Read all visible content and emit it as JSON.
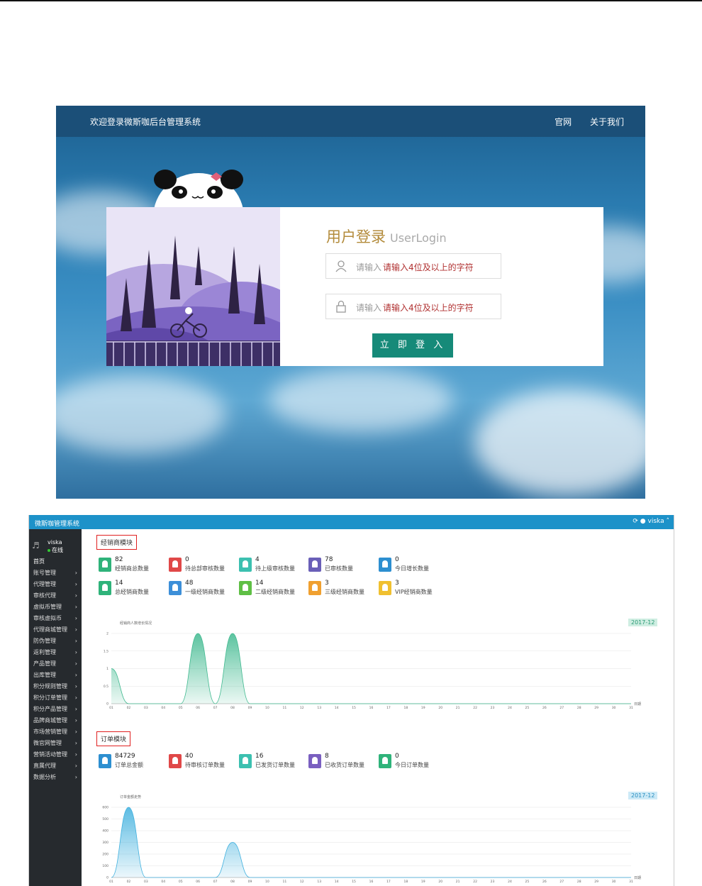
{
  "login": {
    "header_title": "欢迎登录微斯咖后台管理系统",
    "nav": [
      "官网",
      "关于我们"
    ],
    "heading": "用户登录",
    "heading_en": "UserLogin",
    "username": {
      "placeholder": "请输入",
      "hint": "请输入4位及以上的字符"
    },
    "password": {
      "placeholder": "请输入",
      "hint": "请输入4位及以上的字符"
    },
    "submit_label": "立 即 登 入",
    "colors": {
      "header": "#1b4f78",
      "button": "#168a79",
      "heading": "#b38b3b"
    }
  },
  "dashboard": {
    "app_title": "微斯咖管理系统",
    "user_name": "viska",
    "user_status": "在线",
    "top_user": "viska",
    "menu": [
      {
        "label": "首页",
        "arrow": ""
      },
      {
        "label": "账号管理",
        "arrow": "›"
      },
      {
        "label": "代理管理",
        "arrow": "›"
      },
      {
        "label": "审核代理",
        "arrow": "›"
      },
      {
        "label": "虚拟币管理",
        "arrow": "›"
      },
      {
        "label": "审核虚拟币",
        "arrow": "›"
      },
      {
        "label": "代理商城管理",
        "arrow": "›"
      },
      {
        "label": "防伪管理",
        "arrow": "›"
      },
      {
        "label": "返利管理",
        "arrow": "›"
      },
      {
        "label": "产品管理",
        "arrow": "›"
      },
      {
        "label": "出库管理",
        "arrow": "›"
      },
      {
        "label": "积分规则管理",
        "arrow": "›"
      },
      {
        "label": "积分订单管理",
        "arrow": "›"
      },
      {
        "label": "积分产品管理",
        "arrow": "›"
      },
      {
        "label": "品牌商城管理",
        "arrow": "›"
      },
      {
        "label": "市场营销管理",
        "arrow": "›"
      },
      {
        "label": "微官网管理",
        "arrow": "›"
      },
      {
        "label": "营销活动管理",
        "arrow": "›"
      },
      {
        "label": "直属代理",
        "arrow": "›"
      },
      {
        "label": "数据分析",
        "arrow": "›"
      }
    ],
    "dealer_module": {
      "title": "经销商模块",
      "stats": [
        {
          "value": "82",
          "label": "经销商总数量",
          "color": "#2fb37a"
        },
        {
          "value": "0",
          "label": "待总部审核数量",
          "color": "#e04848"
        },
        {
          "value": "4",
          "label": "待上级审核数量",
          "color": "#3cc0b0"
        },
        {
          "value": "78",
          "label": "已审核数量",
          "color": "#6a5fb8"
        },
        {
          "value": "0",
          "label": "今日增长数量",
          "color": "#2d8fd0"
        },
        {
          "value": "14",
          "label": "总经销商数量",
          "color": "#2fb37a"
        },
        {
          "value": "48",
          "label": "一级经销商数量",
          "color": "#3d8fd8"
        },
        {
          "value": "14",
          "label": "二级经销商数量",
          "color": "#5fbf45"
        },
        {
          "value": "3",
          "label": "三级经销商数量",
          "color": "#f0a030"
        },
        {
          "value": "3",
          "label": "VIP经销商数量",
          "color": "#f0c030"
        }
      ]
    },
    "order_module": {
      "title": "订单模块",
      "stats": [
        {
          "value": "84729",
          "label": "订单总金额",
          "color": "#2d8fd0"
        },
        {
          "value": "40",
          "label": "待审核订单数量",
          "color": "#e04848"
        },
        {
          "value": "16",
          "label": "已发货订单数量",
          "color": "#3cc0b0"
        },
        {
          "value": "8",
          "label": "已收货订单数量",
          "color": "#7a5fc0"
        },
        {
          "value": "0",
          "label": "今日订单数量",
          "color": "#2fb37a"
        }
      ]
    }
  },
  "chart_data": [
    {
      "type": "area",
      "title": "经销商人数增长情况",
      "x": [
        "01",
        "02",
        "03",
        "04",
        "05",
        "06",
        "07",
        "08",
        "09",
        "10",
        "11",
        "12",
        "13",
        "14",
        "15",
        "16",
        "17",
        "18",
        "19",
        "20",
        "21",
        "22",
        "23",
        "24",
        "25",
        "26",
        "27",
        "28",
        "29",
        "30",
        "31"
      ],
      "values": [
        1,
        0,
        0,
        0,
        0,
        2,
        0,
        2,
        0,
        0,
        0,
        0,
        0,
        0,
        0,
        0,
        0,
        0,
        0,
        0,
        0,
        0,
        0,
        0,
        0,
        0,
        0,
        0,
        0,
        0,
        0
      ],
      "ylim": [
        0,
        2
      ],
      "yticks": [
        "0",
        "0.5",
        "1",
        "1.5",
        "2"
      ],
      "xlabel": "日期",
      "date_badge": "2017-12",
      "color": "#3fb98f"
    },
    {
      "type": "area",
      "title": "订单金额走势",
      "x": [
        "01",
        "02",
        "03",
        "04",
        "05",
        "06",
        "07",
        "08",
        "09",
        "10",
        "11",
        "12",
        "13",
        "14",
        "15",
        "16",
        "17",
        "18",
        "19",
        "20",
        "21",
        "22",
        "23",
        "24",
        "25",
        "26",
        "27",
        "28",
        "29",
        "30",
        "31"
      ],
      "values": [
        0,
        600,
        0,
        0,
        0,
        0,
        0,
        300,
        0,
        0,
        0,
        0,
        0,
        0,
        0,
        0,
        0,
        0,
        0,
        0,
        0,
        0,
        0,
        0,
        0,
        0,
        0,
        0,
        0,
        0,
        0
      ],
      "ylim": [
        0,
        600
      ],
      "yticks": [
        "0",
        "100",
        "200",
        "300",
        "400",
        "500",
        "600"
      ],
      "xlabel": "日期",
      "date_badge": "2017-12",
      "color": "#3fb0de"
    }
  ]
}
